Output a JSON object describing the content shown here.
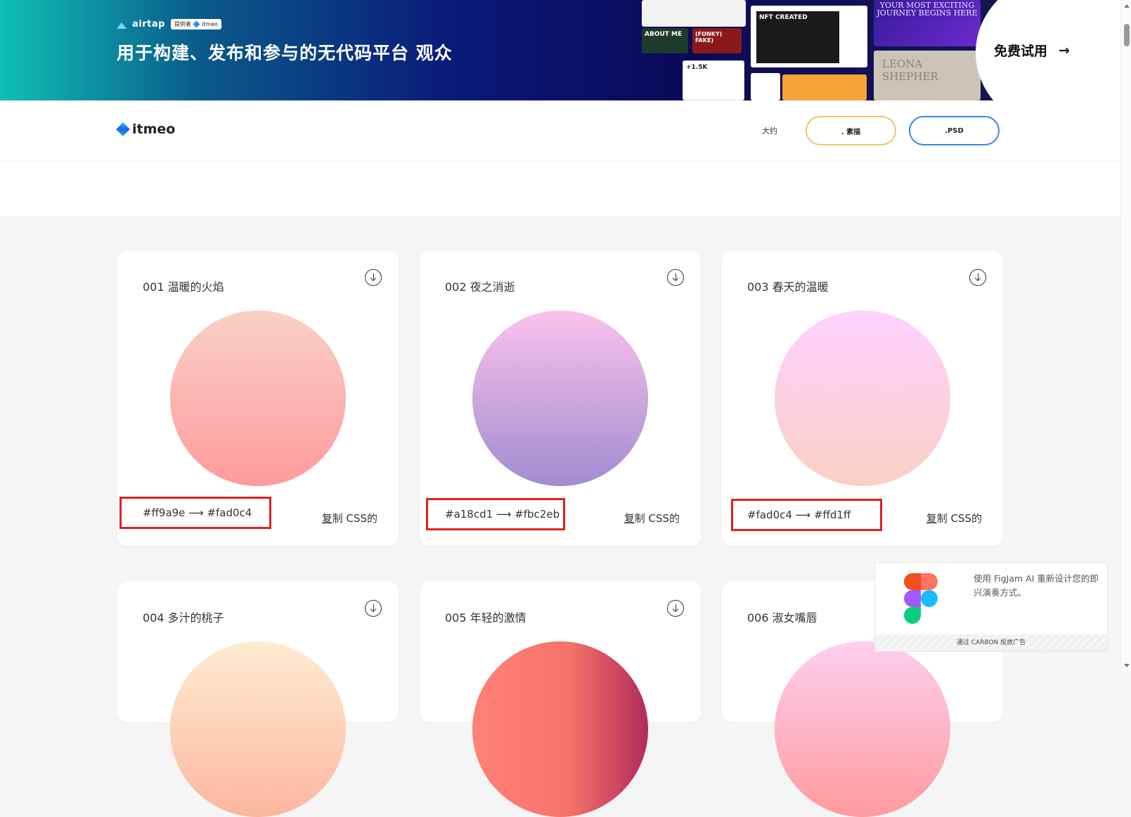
{
  "banner": {
    "brand": "airtap",
    "provided_label": "提供者",
    "provided_partner": "itmeo",
    "headline": "用于构建、发布和参与的无代码平台 观众",
    "trial_label": "免费试用",
    "trial_arrow": "→",
    "thumb_nft": "NFT CREATED",
    "thumb_about": "ABOUT ME",
    "thumb_fonky": "(FONKY) FAKE)",
    "thumb_stat": "+1.5K",
    "thumb_journey": "YOUR MOST EXCITING JOURNEY BEGINS HERE",
    "thumb_leona": "LEONA SHEPHER"
  },
  "header": {
    "logo_text": "itmeo",
    "nav_about": "大约",
    "sketch_label": ". 素描",
    "psd_label": ".PSD"
  },
  "cards": [
    {
      "title": "001 温暖的火焰",
      "from": "#ff9a9e",
      "to": "#fad0c4",
      "hex_text": "#ff9a9e  ⟶  #fad0c4",
      "copy_prefix": "复",
      "copy_rest": "制 CSS的"
    },
    {
      "title": "002 夜之消逝",
      "from": "#a18cd1",
      "to": "#fbc2eb",
      "hex_text": "#a18cd1  ⟶  #fbc2eb",
      "copy_prefix": "复",
      "copy_rest": "制 CSS的"
    },
    {
      "title": "003 春天的温暖",
      "from": "#fad0c4",
      "to": "#ffd1ff",
      "hex_text": "#fad0c4  ⟶  #ffd1ff",
      "copy_prefix": "复",
      "copy_rest": "制 CSS的"
    },
    {
      "title": "004 多汁的桃子",
      "from": "#ffecd2",
      "to": "#fcb69f"
    },
    {
      "title": "005 年轻的激情",
      "from": "#ff8177",
      "to": "#b12a5b"
    },
    {
      "title": "006 淑女嘴唇",
      "from": "#ff9a9e",
      "to": "#fecfef"
    }
  ],
  "ad": {
    "text": "使用 FigJam AI 重新设计您的即兴演奏方式。",
    "footer": "通过 CARBON 投放广告"
  }
}
